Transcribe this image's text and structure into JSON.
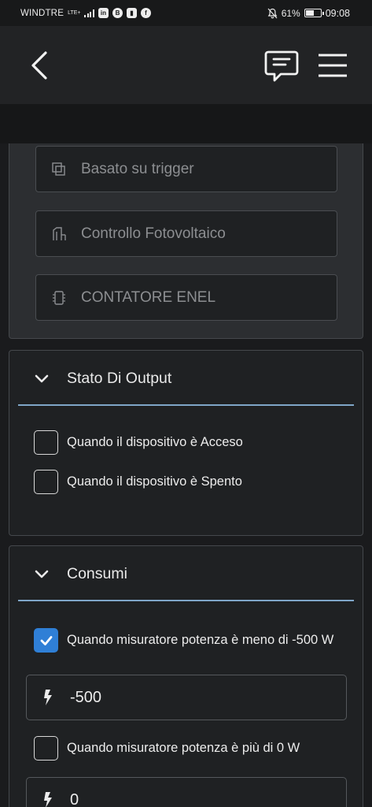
{
  "status_bar": {
    "carrier": "WINDTRE",
    "network": "LTE+",
    "battery": "61%",
    "battery_level": 0.61,
    "time": "09:08",
    "app_icons": [
      "inv-app-icon",
      "b-app-icon",
      "twitch-icon",
      "facebook-icon"
    ]
  },
  "header": {
    "back_icon": "chevron-left-icon",
    "chat_icon": "chat-bubble-icon",
    "menu_icon": "hamburger-menu-icon"
  },
  "scenario_types": {
    "items": [
      {
        "label": "Basato su trigger",
        "icon": "layers-icon"
      },
      {
        "label": "Controllo Fotovoltaico",
        "icon": "solar-panel-icon"
      },
      {
        "label": "CONTATORE ENEL",
        "icon": "chip-icon"
      }
    ]
  },
  "output_state": {
    "title": "Stato Di Output",
    "options": [
      {
        "label": "Quando il dispositivo è Acceso",
        "checked": false
      },
      {
        "label": "Quando il dispositivo è Spento",
        "checked": false
      }
    ]
  },
  "consumption": {
    "title": "Consumi",
    "options": [
      {
        "label": "Quando misuratore potenza è meno di -500 W",
        "checked": true,
        "value": "-500"
      },
      {
        "label": "Quando misuratore potenza è più di 0 W",
        "checked": false,
        "value": "0"
      }
    ]
  },
  "colors": {
    "accent": "#2f7fd6",
    "divider": "#7fa6c8",
    "card_bg": "#1f2123"
  }
}
